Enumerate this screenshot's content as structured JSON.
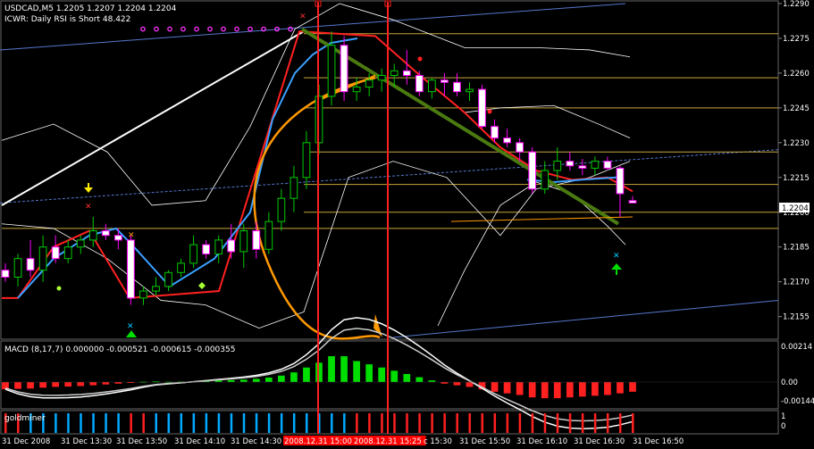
{
  "header": {
    "symbol_line": "USDCAD,M5  1.2205 1.2207 1.2204 1.2204",
    "indicator_line": "ICWR: Daily RSI is Short 48.422"
  },
  "macd": {
    "label": "MACD  (8,17,7) 0.000000 -0.000521 -0.000615 -0.000355",
    "ticks": [
      "0.00214",
      "0.00",
      "-0.00144"
    ]
  },
  "goldminer": {
    "label": "goldminer",
    "ticks": [
      "1",
      "0"
    ]
  },
  "price_badge": "1.2204",
  "chart_data": {
    "type": "candlestick",
    "title": "USDCAD,M5",
    "ylim": [
      1.2146,
      1.229
    ],
    "price_ticks": [
      "1.2290",
      "1.2275",
      "1.2260",
      "1.2245",
      "1.2230",
      "1.2215",
      "1.2200",
      "1.2185",
      "1.2170",
      "1.2155"
    ],
    "time_labels": [
      "31 Dec 2008",
      "31 Dec 13:30",
      "31 Dec 13:50",
      "31 Dec 14:10",
      "31 Dec 14:30",
      "2008.12.31 15:00",
      "2008.12.31 15:25",
      "c 15:30",
      "31 Dec 15:50",
      "31 Dec 16:10",
      "31 Dec 16:30",
      "31 Dec 16:50"
    ],
    "highlighted_time_labels": [
      5,
      6
    ],
    "current_price": 1.2204,
    "candles": [
      {
        "o": 1.2175,
        "h": 1.2178,
        "l": 1.217,
        "c": 1.2172
      },
      {
        "o": 1.2172,
        "h": 1.2182,
        "l": 1.2168,
        "c": 1.218
      },
      {
        "o": 1.218,
        "h": 1.2188,
        "l": 1.2172,
        "c": 1.2175
      },
      {
        "o": 1.2175,
        "h": 1.219,
        "l": 1.217,
        "c": 1.2185
      },
      {
        "o": 1.2185,
        "h": 1.219,
        "l": 1.2178,
        "c": 1.218
      },
      {
        "o": 1.218,
        "h": 1.2188,
        "l": 1.2178,
        "c": 1.2185
      },
      {
        "o": 1.2185,
        "h": 1.219,
        "l": 1.2182,
        "c": 1.2188
      },
      {
        "o": 1.2188,
        "h": 1.2198,
        "l": 1.2185,
        "c": 1.2192
      },
      {
        "o": 1.2192,
        "h": 1.2195,
        "l": 1.2188,
        "c": 1.219
      },
      {
        "o": 1.219,
        "h": 1.2193,
        "l": 1.2184,
        "c": 1.2188
      },
      {
        "o": 1.2188,
        "h": 1.219,
        "l": 1.216,
        "c": 1.2163
      },
      {
        "o": 1.2163,
        "h": 1.2168,
        "l": 1.216,
        "c": 1.2166
      },
      {
        "o": 1.2166,
        "h": 1.2172,
        "l": 1.2164,
        "c": 1.2168
      },
      {
        "o": 1.2168,
        "h": 1.2175,
        "l": 1.2166,
        "c": 1.2174
      },
      {
        "o": 1.2174,
        "h": 1.218,
        "l": 1.2172,
        "c": 1.2178
      },
      {
        "o": 1.2178,
        "h": 1.219,
        "l": 1.2176,
        "c": 1.2186
      },
      {
        "o": 1.2186,
        "h": 1.2188,
        "l": 1.218,
        "c": 1.2182
      },
      {
        "o": 1.2182,
        "h": 1.219,
        "l": 1.2178,
        "c": 1.2188
      },
      {
        "o": 1.2188,
        "h": 1.2195,
        "l": 1.218,
        "c": 1.2183
      },
      {
        "o": 1.2183,
        "h": 1.2195,
        "l": 1.2176,
        "c": 1.2192
      },
      {
        "o": 1.2192,
        "h": 1.2196,
        "l": 1.218,
        "c": 1.2184
      },
      {
        "o": 1.2184,
        "h": 1.22,
        "l": 1.2182,
        "c": 1.2196
      },
      {
        "o": 1.2196,
        "h": 1.221,
        "l": 1.2192,
        "c": 1.2206
      },
      {
        "o": 1.2206,
        "h": 1.222,
        "l": 1.22,
        "c": 1.2215
      },
      {
        "o": 1.2215,
        "h": 1.2235,
        "l": 1.221,
        "c": 1.223
      },
      {
        "o": 1.223,
        "h": 1.2255,
        "l": 1.2225,
        "c": 1.225
      },
      {
        "o": 1.225,
        "h": 1.2278,
        "l": 1.2246,
        "c": 1.2272
      },
      {
        "o": 1.2272,
        "h": 1.2276,
        "l": 1.2248,
        "c": 1.2252
      },
      {
        "o": 1.2252,
        "h": 1.2258,
        "l": 1.2248,
        "c": 1.2254
      },
      {
        "o": 1.2254,
        "h": 1.226,
        "l": 1.225,
        "c": 1.2257
      },
      {
        "o": 1.2257,
        "h": 1.2262,
        "l": 1.2252,
        "c": 1.2259
      },
      {
        "o": 1.2259,
        "h": 1.2264,
        "l": 1.2254,
        "c": 1.2261
      },
      {
        "o": 1.2261,
        "h": 1.227,
        "l": 1.2255,
        "c": 1.2259
      },
      {
        "o": 1.2259,
        "h": 1.2261,
        "l": 1.225,
        "c": 1.2252
      },
      {
        "o": 1.2252,
        "h": 1.2258,
        "l": 1.2249,
        "c": 1.2257
      },
      {
        "o": 1.2257,
        "h": 1.226,
        "l": 1.225,
        "c": 1.2256
      },
      {
        "o": 1.2256,
        "h": 1.226,
        "l": 1.225,
        "c": 1.2252
      },
      {
        "o": 1.2252,
        "h": 1.2256,
        "l": 1.2248,
        "c": 1.2253
      },
      {
        "o": 1.2253,
        "h": 1.2255,
        "l": 1.2236,
        "c": 1.2237
      },
      {
        "o": 1.2237,
        "h": 1.224,
        "l": 1.223,
        "c": 1.2232
      },
      {
        "o": 1.2232,
        "h": 1.2236,
        "l": 1.2228,
        "c": 1.223
      },
      {
        "o": 1.223,
        "h": 1.2232,
        "l": 1.2222,
        "c": 1.2226
      },
      {
        "o": 1.2226,
        "h": 1.2228,
        "l": 1.2208,
        "c": 1.221
      },
      {
        "o": 1.221,
        "h": 1.2222,
        "l": 1.2208,
        "c": 1.2218
      },
      {
        "o": 1.2218,
        "h": 1.2228,
        "l": 1.2214,
        "c": 1.2222
      },
      {
        "o": 1.2222,
        "h": 1.2226,
        "l": 1.2218,
        "c": 1.222
      },
      {
        "o": 1.222,
        "h": 1.2223,
        "l": 1.2216,
        "c": 1.2219
      },
      {
        "o": 1.2219,
        "h": 1.2224,
        "l": 1.2216,
        "c": 1.2222
      },
      {
        "o": 1.2222,
        "h": 1.2224,
        "l": 1.2218,
        "c": 1.2219
      },
      {
        "o": 1.2219,
        "h": 1.222,
        "l": 1.2198,
        "c": 1.2208
      },
      {
        "o": 1.2205,
        "h": 1.2207,
        "l": 1.2204,
        "c": 1.2204
      }
    ],
    "macd_hist": [
      -0.00045,
      -0.00042,
      -0.0004,
      -0.00035,
      -0.0003,
      -0.00028,
      -0.00025,
      -0.0002,
      -0.00015,
      -0.0001,
      -5e-05,
      2e-05,
      4e-05,
      2e-05,
      3e-05,
      5e-05,
      8e-05,
      0.0001,
      0.00012,
      0.00015,
      0.0002,
      0.00028,
      0.0004,
      0.0006,
      0.0009,
      0.0012,
      0.0016,
      0.0016,
      0.0013,
      0.0011,
      0.0009,
      0.0007,
      0.0005,
      0.0003,
      0.0001,
      -0.0001,
      -0.0002,
      -0.0003,
      -0.00045,
      -0.0006,
      -0.0007,
      -0.0008,
      -0.00095,
      -0.001,
      -0.001,
      -0.00095,
      -0.0009,
      -0.00085,
      -0.0008,
      -0.0007,
      -0.0006
    ],
    "goldminer_bars": [
      "#ff2020",
      "#ff2020",
      "#00aaff",
      "#00aaff",
      "#00aaff",
      "#00aaff",
      "#00aaff",
      "#00aaff",
      "#00aaff",
      "#00aaff",
      "#ff2020",
      "#ff2020",
      "#00aaff",
      "#00aaff",
      "#00aaff",
      "#00aaff",
      "#00aaff",
      "#00aaff",
      "#00aaff",
      "#00aaff",
      "#00aaff",
      "#00aaff",
      "#00aaff",
      "#00aaff",
      "#00aaff",
      "#00aaff",
      "#00aaff",
      "#00aaff",
      "#ff2020",
      "#ff2020",
      "#ff2020",
      "#ff2020",
      "#ff2020",
      "#ff2020",
      "#ff2020",
      "#ff2020",
      "#ff2020",
      "#ff2020",
      "#ff2020",
      "#ff2020",
      "#ff2020",
      "#ff2020",
      "#ff2020",
      "#ff2020",
      "#ff2020",
      "#ff2020",
      "#ff2020",
      "#ff2020",
      "#ff2020",
      "#ff2020",
      "#ff2020"
    ],
    "colors": {
      "bull_body": "#000000",
      "bull_border": "#00cc00",
      "bear_body": "#ffffff",
      "bear_border": "#ff00ff",
      "grid_line": "#c8a53c",
      "red_line": "#ff2020",
      "blue_line": "#3aa0ff",
      "green_channel": "#4a7a10",
      "orange": "#ff9900",
      "magenta_dots": "#ff33ff"
    }
  }
}
